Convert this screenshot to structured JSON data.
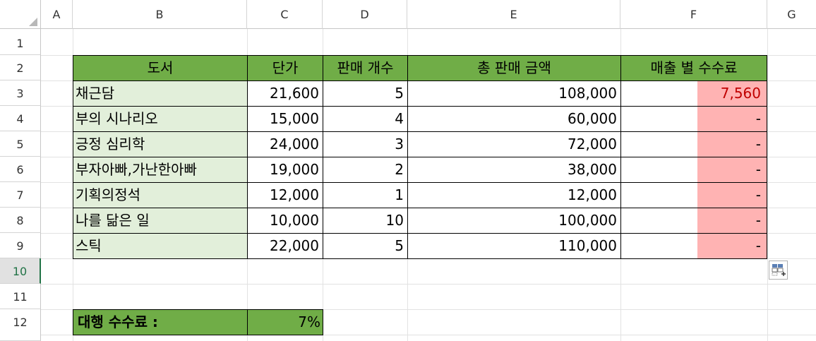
{
  "columns": [
    "A",
    "B",
    "C",
    "D",
    "E",
    "F",
    "G"
  ],
  "rows": [
    "1",
    "2",
    "3",
    "4",
    "5",
    "6",
    "7",
    "8",
    "9",
    "10",
    "11",
    "12"
  ],
  "table": {
    "headers": [
      "도서",
      "단가",
      "판매 개수",
      "총 판매 금액",
      "매출 별 수수료"
    ],
    "rows": [
      {
        "book": "채근담",
        "price": "21,600",
        "qty": "5",
        "total": "108,000",
        "fee": "7,560"
      },
      {
        "book": "부의 시나리오",
        "price": "15,000",
        "qty": "4",
        "total": "60,000",
        "fee": "-"
      },
      {
        "book": "긍정 심리학",
        "price": "24,000",
        "qty": "3",
        "total": "72,000",
        "fee": "-"
      },
      {
        "book": "부자아빠,가난한아빠",
        "price": "19,000",
        "qty": "2",
        "total": "38,000",
        "fee": "-"
      },
      {
        "book": "기획의정석",
        "price": "12,000",
        "qty": "1",
        "total": "12,000",
        "fee": "-"
      },
      {
        "book": "나를 닮은 일",
        "price": "10,000",
        "qty": "10",
        "total": "100,000",
        "fee": "-"
      },
      {
        "book": "스틱",
        "price": "22,000",
        "qty": "5",
        "total": "110,000",
        "fee": "-"
      }
    ]
  },
  "agency_fee": {
    "label": "대행 수수료 :",
    "value": "7%"
  },
  "selected_row": "10",
  "colors": {
    "header_green": "#70ad47",
    "book_bg": "#e2efda",
    "fee_bg": "#ffb3b3",
    "fee_text": "#c00000",
    "select_green": "#217346"
  },
  "quick_analysis_icon": "quick-analysis-icon"
}
